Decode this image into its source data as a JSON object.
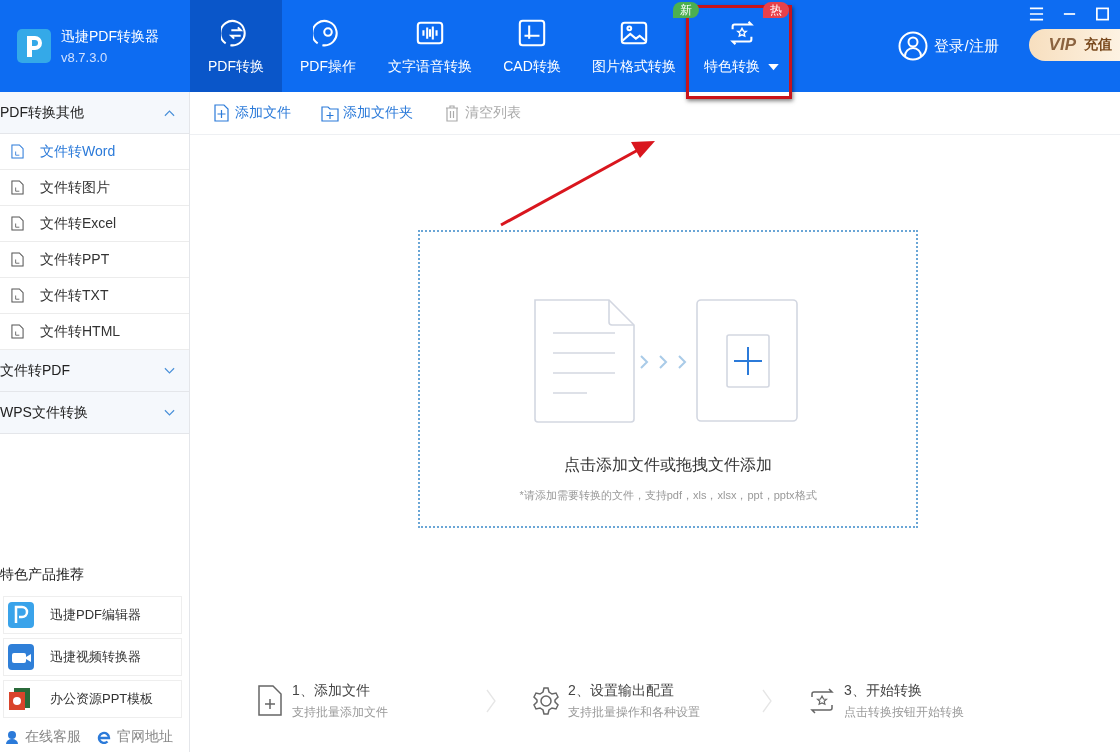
{
  "app": {
    "name": "迅捷PDF转换器",
    "version": "v8.7.3.0"
  },
  "nav_tabs": [
    {
      "label": "PDF转换",
      "selected": true
    },
    {
      "label": "PDF操作",
      "selected": false
    },
    {
      "label": "文字语音转换",
      "selected": false
    },
    {
      "label": "CAD转换",
      "selected": false
    },
    {
      "label": "图片格式转换",
      "selected": false,
      "badge": "新",
      "color": "#4cb050"
    },
    {
      "label": "特色转换",
      "selected": false,
      "badge": "热",
      "color": "#e8414a",
      "dropdown": true
    }
  ],
  "login": "登录/注册",
  "vip": {
    "mark": "VIP",
    "label": "充值"
  },
  "toolbar": [
    {
      "label": "添加文件",
      "disabled": false
    },
    {
      "label": "添加文件夹",
      "disabled": false
    },
    {
      "label": "清空列表",
      "disabled": true
    }
  ],
  "sidebar": {
    "groups": [
      {
        "label": "PDF转换其他",
        "expanded": true,
        "items": [
          {
            "label": "文件转Word",
            "selected": true
          },
          {
            "label": "文件转图片",
            "selected": false
          },
          {
            "label": "文件转Excel",
            "selected": false
          },
          {
            "label": "文件转PPT",
            "selected": false
          },
          {
            "label": "文件转TXT",
            "selected": false
          },
          {
            "label": "文件转HTML",
            "selected": false
          }
        ]
      },
      {
        "label": "文件转PDF",
        "expanded": false
      },
      {
        "label": "WPS文件转换",
        "expanded": false
      }
    ],
    "products_title": "特色产品推荐",
    "products": [
      "迅捷PDF编辑器",
      "迅捷视频转换器",
      "办公资源PPT模板"
    ],
    "links": [
      "在线客服",
      "官网地址"
    ]
  },
  "dropzone": {
    "title": "点击添加文件或拖拽文件添加",
    "hint": "*请添加需要转换的文件，支持pdf，xls，xlsx，ppt，pptx格式"
  },
  "steps": [
    {
      "title": "1、添加文件",
      "subtitle": "支持批量添加文件"
    },
    {
      "title": "2、设置输出配置",
      "subtitle": "支持批量操作和各种设置"
    },
    {
      "title": "3、开始转换",
      "subtitle": "点击转换按钮开始转换"
    }
  ]
}
